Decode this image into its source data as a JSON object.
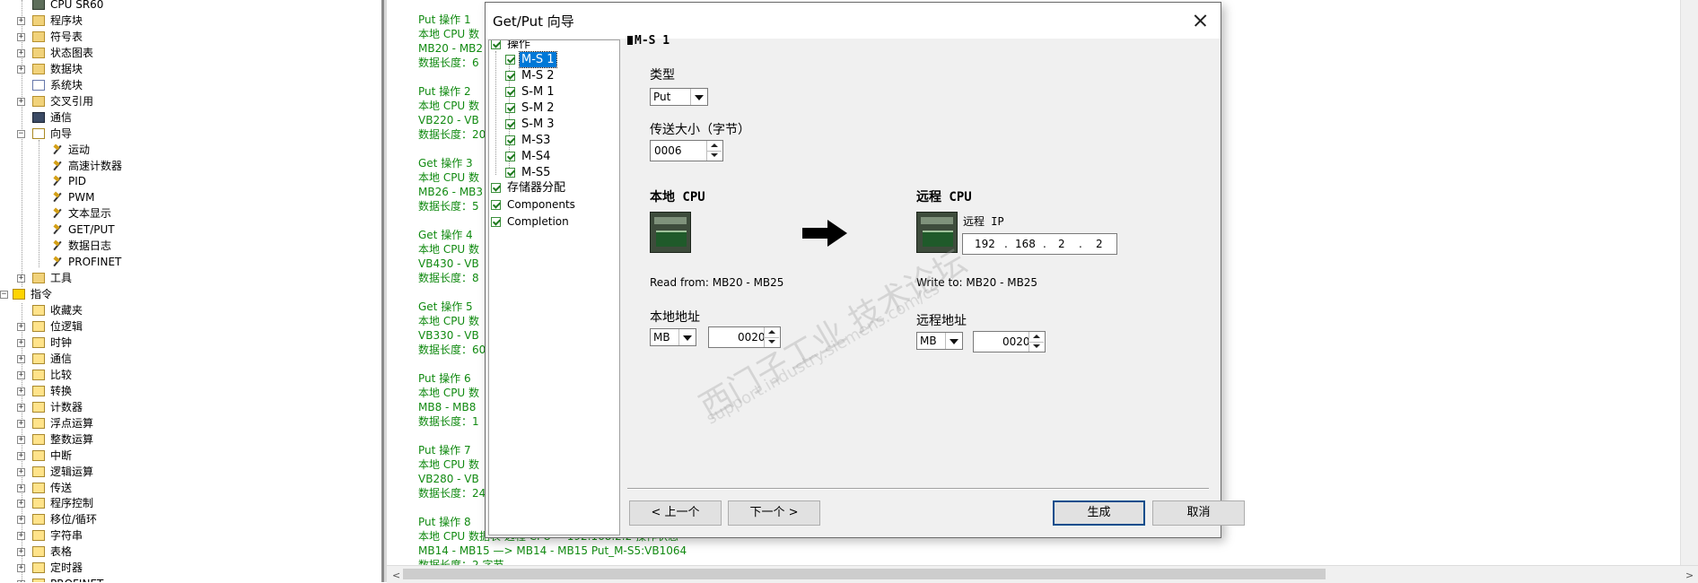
{
  "tree": {
    "items": [
      {
        "label": "CPU SR60",
        "icon": "cpu-icon"
      },
      {
        "label": "程序块",
        "icon": "folder-icon"
      },
      {
        "label": "符号表",
        "icon": "folder-icon"
      },
      {
        "label": "状态图表",
        "icon": "folder-icon"
      },
      {
        "label": "数据块",
        "icon": "folder-icon"
      },
      {
        "label": "系统块",
        "icon": "document-icon"
      },
      {
        "label": "交叉引用",
        "icon": "folder-icon"
      },
      {
        "label": "通信",
        "icon": "network-icon"
      },
      {
        "label": "向导",
        "icon": "wizard-folder-icon"
      },
      {
        "label": "运动",
        "icon": "wizard-tool-icon"
      },
      {
        "label": "高速计数器",
        "icon": "wizard-tool-icon"
      },
      {
        "label": "PID",
        "icon": "wizard-tool-icon"
      },
      {
        "label": "PWM",
        "icon": "wizard-tool-icon"
      },
      {
        "label": "文本显示",
        "icon": "wizard-tool-icon"
      },
      {
        "label": "GET/PUT",
        "icon": "wizard-tool-icon"
      },
      {
        "label": "数据日志",
        "icon": "wizard-tool-icon"
      },
      {
        "label": "PROFINET",
        "icon": "wizard-tool-icon"
      },
      {
        "label": "工具",
        "icon": "folder-icon"
      },
      {
        "label": "指令",
        "icon": "instructions-icon"
      },
      {
        "label": "收藏夹",
        "icon": "instruction-folder-icon"
      },
      {
        "label": "位逻辑",
        "icon": "instruction-folder-icon"
      },
      {
        "label": "时钟",
        "icon": "instruction-folder-icon"
      },
      {
        "label": "通信",
        "icon": "instruction-folder-icon"
      },
      {
        "label": "比较",
        "icon": "instruction-folder-icon"
      },
      {
        "label": "转换",
        "icon": "instruction-folder-icon"
      },
      {
        "label": "计数器",
        "icon": "instruction-folder-icon"
      },
      {
        "label": "浮点运算",
        "icon": "instruction-folder-icon"
      },
      {
        "label": "整数运算",
        "icon": "instruction-folder-icon"
      },
      {
        "label": "中断",
        "icon": "instruction-folder-icon"
      },
      {
        "label": "逻辑运算",
        "icon": "instruction-folder-icon"
      },
      {
        "label": "传送",
        "icon": "instruction-folder-icon"
      },
      {
        "label": "程序控制",
        "icon": "instruction-folder-icon"
      },
      {
        "label": "移位/循环",
        "icon": "instruction-folder-icon"
      },
      {
        "label": "字符串",
        "icon": "instruction-folder-icon"
      },
      {
        "label": "表格",
        "icon": "instruction-folder-icon"
      },
      {
        "label": "定时器",
        "icon": "instruction-folder-icon"
      },
      {
        "label": "PROFINET",
        "icon": "instruction-folder-icon"
      }
    ]
  },
  "background": {
    "blocks": [
      {
        "lines": [
          "Put      操作 1",
          "本地 CPU 数",
          " MB20 - MB2",
          "数据长度：6"
        ]
      },
      {
        "lines": [
          "Put      操作 2",
          "本地 CPU 数",
          " VB220 - VB",
          "数据长度：20"
        ]
      },
      {
        "lines": [
          "Get      操作 3",
          "本地 CPU 数",
          " MB26 - MB3",
          "数据长度：5"
        ]
      },
      {
        "lines": [
          "Get      操作 4",
          "本地 CPU 数",
          " VB430 - VB",
          "数据长度：8"
        ]
      },
      {
        "lines": [
          "Get      操作 5",
          "本地 CPU 数",
          " VB330 - VB",
          "数据长度：60"
        ]
      },
      {
        "lines": [
          "Put      操作 6",
          "本地 CPU 数",
          " MB8 - MB8",
          "数据长度：1"
        ]
      },
      {
        "lines": [
          "Put      操作 7",
          "本地 CPU 数",
          " VB280 - VB",
          "数据长度：24"
        ]
      },
      {
        "lines": [
          "Put      操作 8",
          "本地 CPU 数据表     远程 CPU = 192.168.2.2    操作状态",
          " MB14 - MB15            —> MB14 - MB15          Put_M-S5:VB1064",
          "数据长度：2 字节"
        ]
      }
    ]
  },
  "dialog": {
    "title": "Get/Put 向导",
    "tree": {
      "root": "操作",
      "operations": [
        "M-S 1",
        "M-S 2",
        "S-M 1",
        "S-M 2",
        "S-M 3",
        "M-S3",
        "M-S4",
        "M-S5"
      ],
      "selected": "M-S 1",
      "others": [
        "存储器分配",
        "Components",
        "Completion"
      ]
    },
    "panel": {
      "heading": "M-S 1",
      "type_label": "类型",
      "type_value": "Put",
      "size_label": "传送大小（字节）",
      "size_value": "0006",
      "local_cpu_label": "本地 CPU",
      "remote_cpu_label": "远程 CPU",
      "remote_ip_label": "远程 IP",
      "remote_ip": [
        "192",
        "168",
        "2",
        "2"
      ],
      "read_from": "Read from: MB20 - MB25",
      "write_to": "Write to: MB20 - MB25",
      "local_addr_label": "本地地址",
      "local_area": "MB",
      "local_offset": "0020",
      "remote_addr_label": "远程地址",
      "remote_area": "MB",
      "remote_offset": "0020"
    },
    "buttons": {
      "prev": "< 上一个",
      "next": "下一个 >",
      "generate": "生成",
      "cancel": "取消"
    },
    "watermark": {
      "line1": "西门子工业  技术论坛",
      "line2": "support.industry.siemens.com/cs"
    }
  }
}
